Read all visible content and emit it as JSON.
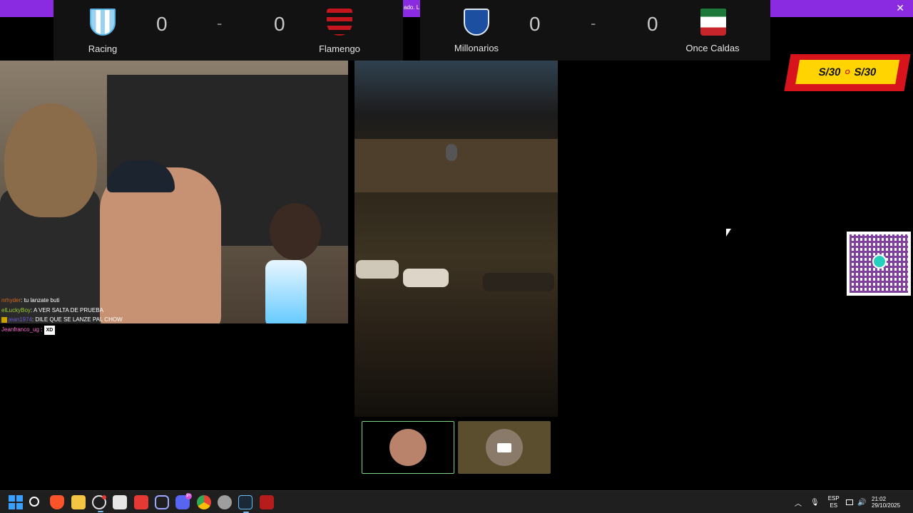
{
  "banner": {
    "text": "ado. L"
  },
  "scoreboards": [
    {
      "home": {
        "name": "Racing",
        "score": "0"
      },
      "separator": "-",
      "away": {
        "name": "Flamengo",
        "score": "0"
      }
    },
    {
      "home": {
        "name": "Millonarios",
        "score": "0"
      },
      "separator": "-",
      "away": {
        "name": "Once Caldas",
        "score": "0"
      }
    }
  ],
  "chat": [
    {
      "user": "nrhyder",
      "message": "tu lanzate buti"
    },
    {
      "user": "elLuckyBoy",
      "message": "A VER SALTA DE PRUEBA"
    },
    {
      "user": "jean1974",
      "message": "DILE QUE SE LANZE PAL CHOW"
    },
    {
      "user": "Jeanfranco_ug",
      "message": "XD"
    }
  ],
  "promo": {
    "amount_left": "S/30",
    "or": "O",
    "amount_right": "S/30"
  },
  "tray": {
    "lang_top": "ESP",
    "lang_bottom": "ES",
    "time": "21:02",
    "date": "29/10/2025",
    "discord_badge": "9+"
  }
}
